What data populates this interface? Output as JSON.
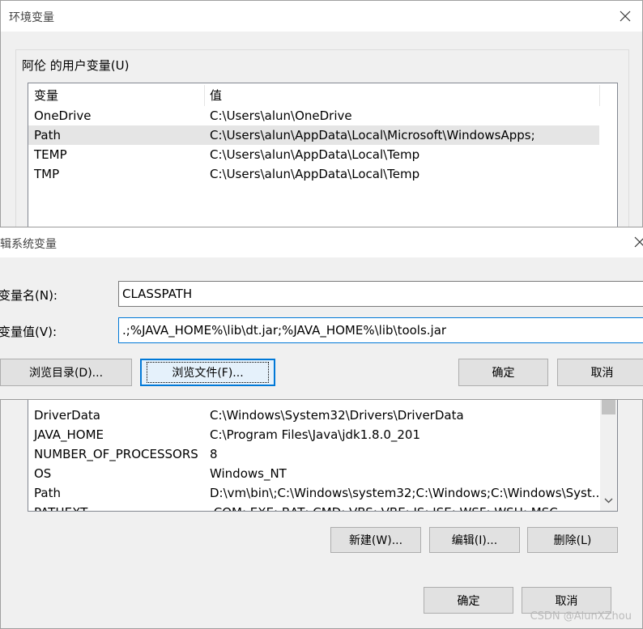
{
  "env_window": {
    "title": "环境变量",
    "user_group_label": "阿伦 的用户变量(U)",
    "user_vars": {
      "columns": [
        "变量",
        "值"
      ],
      "rows": [
        {
          "name": "OneDrive",
          "value": "C:\\Users\\alun\\OneDrive"
        },
        {
          "name": "Path",
          "value": "C:\\Users\\alun\\AppData\\Local\\Microsoft\\WindowsApps;"
        },
        {
          "name": "TEMP",
          "value": "C:\\Users\\alun\\AppData\\Local\\Temp"
        },
        {
          "name": "TMP",
          "value": "C:\\Users\\alun\\AppData\\Local\\Temp"
        }
      ]
    },
    "system_vars": {
      "rows": [
        {
          "name": "DriverData",
          "value": "C:\\Windows\\System32\\Drivers\\DriverData"
        },
        {
          "name": "JAVA_HOME",
          "value": "C:\\Program Files\\Java\\jdk1.8.0_201"
        },
        {
          "name": "NUMBER_OF_PROCESSORS",
          "value": "8"
        },
        {
          "name": "OS",
          "value": "Windows_NT"
        },
        {
          "name": "Path",
          "value": "D:\\vm\\bin\\;C:\\Windows\\system32;C:\\Windows;C:\\Windows\\Syst..."
        },
        {
          "name": "PATHEXT",
          "value": ".COM;.EXE;.BAT;.CMD;.VBS;.VBE;.JS;.JSE;.WSF;.WSH;.MSC"
        }
      ]
    },
    "buttons": {
      "new": "新建(W)...",
      "edit": "编辑(I)...",
      "delete": "删除(L)",
      "ok": "确定",
      "cancel": "取消"
    }
  },
  "edit_dialog": {
    "title": "编辑系统变量",
    "name_label": "变量名(N):",
    "value_label": "变量值(V):",
    "name_value": "CLASSPATH",
    "value_value": ".;%JAVA_HOME%\\lib\\dt.jar;%JAVA_HOME%\\lib\\tools.jar",
    "buttons": {
      "browse_dir": "浏览目录(D)...",
      "browse_file": "浏览文件(F)...",
      "ok": "确定",
      "cancel": "取消"
    }
  },
  "watermark": "CSDN @AlunXZhou"
}
